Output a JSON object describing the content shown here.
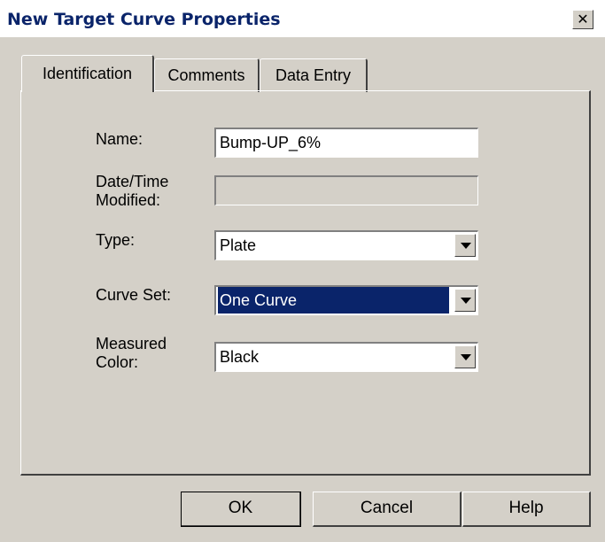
{
  "window": {
    "title": "New Target Curve Properties",
    "close_glyph": "✕"
  },
  "tabs": [
    {
      "label": "Identification",
      "active": true
    },
    {
      "label": "Comments",
      "active": false
    },
    {
      "label": "Data Entry",
      "active": false
    }
  ],
  "form": {
    "name_label": "Name:",
    "name_value": "Bump-UP_6%",
    "date_label_line1": "Date/Time",
    "date_label_line2": "Modified:",
    "date_value": "",
    "type_label": "Type:",
    "type_value": "Plate",
    "curveset_label": "Curve Set:",
    "curveset_value": "One Curve",
    "color_label_line1": "Measured",
    "color_label_line2": "Color:",
    "color_value": "Black"
  },
  "buttons": {
    "ok": "OK",
    "cancel": "Cancel",
    "help": "Help"
  },
  "colors": {
    "face": "#d4d0c8",
    "selection": "#0a246a",
    "title_text": "#0a246a"
  }
}
